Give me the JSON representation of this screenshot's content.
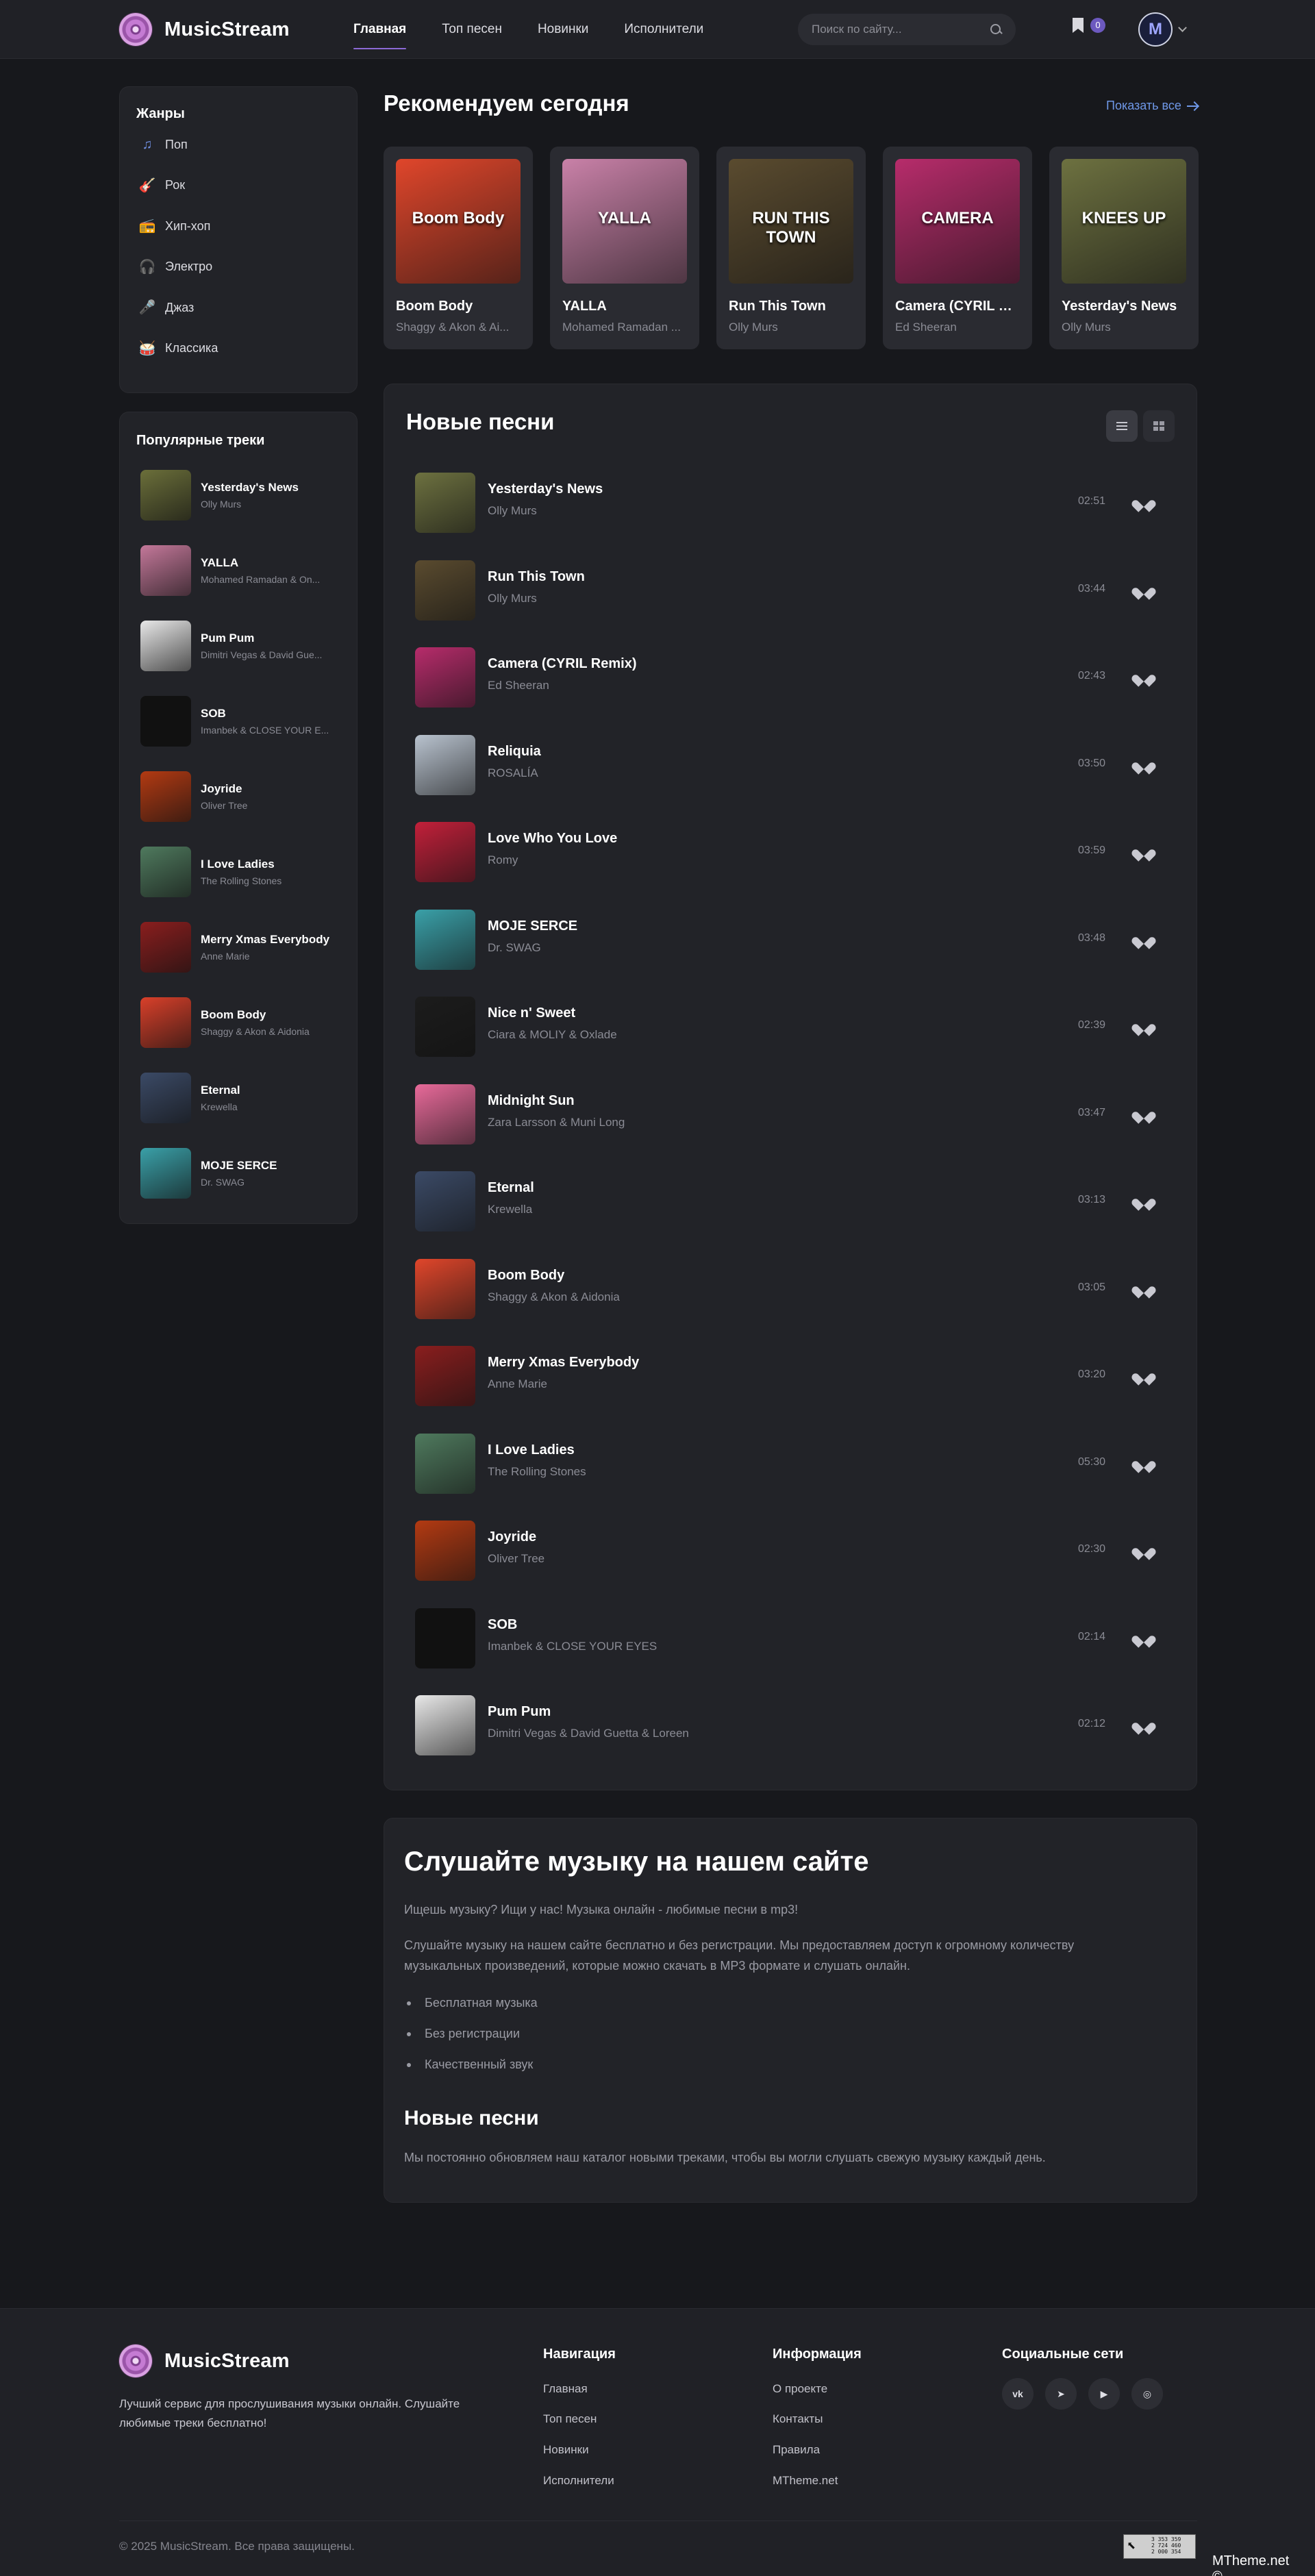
{
  "header": {
    "logo": "MusicStream",
    "nav": [
      {
        "label": "Главная",
        "active": true
      },
      {
        "label": "Топ песен"
      },
      {
        "label": "Новинки"
      },
      {
        "label": "Исполнители"
      }
    ],
    "search_placeholder": "Поиск по сайту...",
    "bookmarks_count": "0",
    "avatar_letter": "M"
  },
  "genres": {
    "title": "Жанры",
    "items": [
      {
        "label": "Поп",
        "icon": "music-note-icon"
      },
      {
        "label": "Рок",
        "icon": "guitar-icon"
      },
      {
        "label": "Хип-хоп",
        "icon": "boombox-icon"
      },
      {
        "label": "Электро",
        "icon": "headphones-icon"
      },
      {
        "label": "Джаз",
        "icon": "microphone-icon"
      },
      {
        "label": "Классика",
        "icon": "drum-icon"
      }
    ]
  },
  "popular": {
    "title": "Популярные треки",
    "items": [
      {
        "title": "Yesterday's News",
        "artist": "Olly Murs",
        "color": "#6b6f3a"
      },
      {
        "title": "YALLA",
        "artist": "Mohamed Ramadan & On...",
        "color": "#c4789a"
      },
      {
        "title": "Pum Pum",
        "artist": "Dimitri Vegas & David Gue...",
        "color": "#e8e8e8"
      },
      {
        "title": "SOB",
        "artist": "Imanbek & CLOSE YOUR E...",
        "color": "#111111"
      },
      {
        "title": "Joyride",
        "artist": "Oliver Tree",
        "color": "#b33a12"
      },
      {
        "title": "I Love Ladies",
        "artist": "The Rolling Stones",
        "color": "#4f7a5e"
      },
      {
        "title": "Merry Xmas Everybody",
        "artist": "Anne Marie",
        "color": "#8a1e1e"
      },
      {
        "title": "Boom Body",
        "artist": "Shaggy & Akon & Aidonia",
        "color": "#d9402a"
      },
      {
        "title": "Eternal",
        "artist": "Krewella",
        "color": "#3b4a66"
      },
      {
        "title": "MOJE SERCE",
        "artist": "Dr. SWAG",
        "color": "#3aa0a8"
      }
    ]
  },
  "recommended": {
    "title": "Рекомендуем сегодня",
    "show_all": "Показать все",
    "items": [
      {
        "title": "Boom Body",
        "artist": "Shaggy & Akon & Ai...",
        "color": "#e0462b",
        "overlay": "Boom Body"
      },
      {
        "title": "YALLA",
        "artist": "Mohamed Ramadan ...",
        "color": "#c981a8",
        "overlay": "YALLA"
      },
      {
        "title": "Run This Town",
        "artist": "Olly Murs",
        "color": "#5a4b2f",
        "overlay": "RUN THIS TOWN"
      },
      {
        "title": "Camera (CYRIL Re...",
        "artist": "Ed Sheeran",
        "color": "#b72c6b",
        "overlay": "CAMERA"
      },
      {
        "title": "Yesterday's News",
        "artist": "Olly Murs",
        "color": "#6d7140",
        "overlay": "KNEES UP"
      }
    ]
  },
  "new_songs": {
    "title": "Новые песни",
    "items": [
      {
        "title": "Yesterday's News",
        "artist": "Olly Murs",
        "duration": "02:51",
        "color": "#6d7140"
      },
      {
        "title": "Run This Town",
        "artist": "Olly Murs",
        "duration": "03:44",
        "color": "#5a4b2f"
      },
      {
        "title": "Camera (CYRIL Remix)",
        "artist": "Ed Sheeran",
        "duration": "02:43",
        "color": "#b72c6b"
      },
      {
        "title": "Reliquia",
        "artist": "ROSALÍA",
        "duration": "03:50",
        "color": "#b9c3cf"
      },
      {
        "title": "Love Who You Love",
        "artist": "Romy",
        "duration": "03:59",
        "color": "#c2203a"
      },
      {
        "title": "MOJE SERCE",
        "artist": "Dr. SWAG",
        "duration": "03:48",
        "color": "#3aa0a8"
      },
      {
        "title": "Nice n' Sweet",
        "artist": "Ciara & MOLIY & Oxlade",
        "duration": "02:39",
        "color": "#1c1c1c"
      },
      {
        "title": "Midnight Sun",
        "artist": "Zara Larsson & Muni Long",
        "duration": "03:47",
        "color": "#e86a9a"
      },
      {
        "title": "Eternal",
        "artist": "Krewella",
        "duration": "03:13",
        "color": "#3b4a66"
      },
      {
        "title": "Boom Body",
        "artist": "Shaggy & Akon & Aidonia",
        "duration": "03:05",
        "color": "#e0462b"
      },
      {
        "title": "Merry Xmas Everybody",
        "artist": "Anne Marie",
        "duration": "03:20",
        "color": "#8a1e1e"
      },
      {
        "title": "I Love Ladies",
        "artist": "The Rolling Stones",
        "duration": "05:30",
        "color": "#4f7a5e"
      },
      {
        "title": "Joyride",
        "artist": "Oliver Tree",
        "duration": "02:30",
        "color": "#b33a12"
      },
      {
        "title": "SOB",
        "artist": "Imanbek & CLOSE YOUR EYES",
        "duration": "02:14",
        "color": "#111111"
      },
      {
        "title": "Pum Pum",
        "artist": "Dimitri Vegas & David Guetta & Loreen",
        "duration": "02:12",
        "color": "#e8e8e8"
      }
    ]
  },
  "seo": {
    "title": "Слушайте музыку на нашем сайте",
    "p1": "Ищешь музыку? Ищи у нас! Музыка онлайн - любимые песни в mp3!",
    "p2": "Слушайте музыку на нашем сайте бесплатно и без регистрации. Мы предоставляем доступ к огромному количеству музыкальных произведений, которые можно скачать в MP3 формате и слушать онлайн.",
    "bullets": [
      "Бесплатная музыка",
      "Без регистрации",
      "Качественный звук"
    ],
    "subtitle": "Новые песни",
    "p3": "Мы постоянно обновляем наш каталог новыми треками, чтобы вы могли слушать свежую музыку каждый день."
  },
  "footer": {
    "logo": "MusicStream",
    "desc": "Лучший сервис для прослушивания музыки онлайн. Слушайте любимые треки бесплатно!",
    "nav_title": "Навигация",
    "nav": [
      "Главная",
      "Топ песен",
      "Новинки",
      "Исполнители"
    ],
    "info_title": "Информация",
    "info": [
      "О проекте",
      "Контакты",
      "Правила",
      "MTheme.net"
    ],
    "social_title": "Социальные сети",
    "social": [
      {
        "icon": "vk-icon",
        "glyph": "vk"
      },
      {
        "icon": "telegram-icon",
        "glyph": "➤"
      },
      {
        "icon": "youtube-icon",
        "glyph": "▶"
      },
      {
        "icon": "instagram-icon",
        "glyph": "◎"
      }
    ],
    "copyright": "© 2025 MusicStream. Все права защищены.",
    "counter_lines": [
      "3 353 359",
      "2 724 460",
      "2 000 354"
    ],
    "watermark": "MTheme.net ©"
  }
}
